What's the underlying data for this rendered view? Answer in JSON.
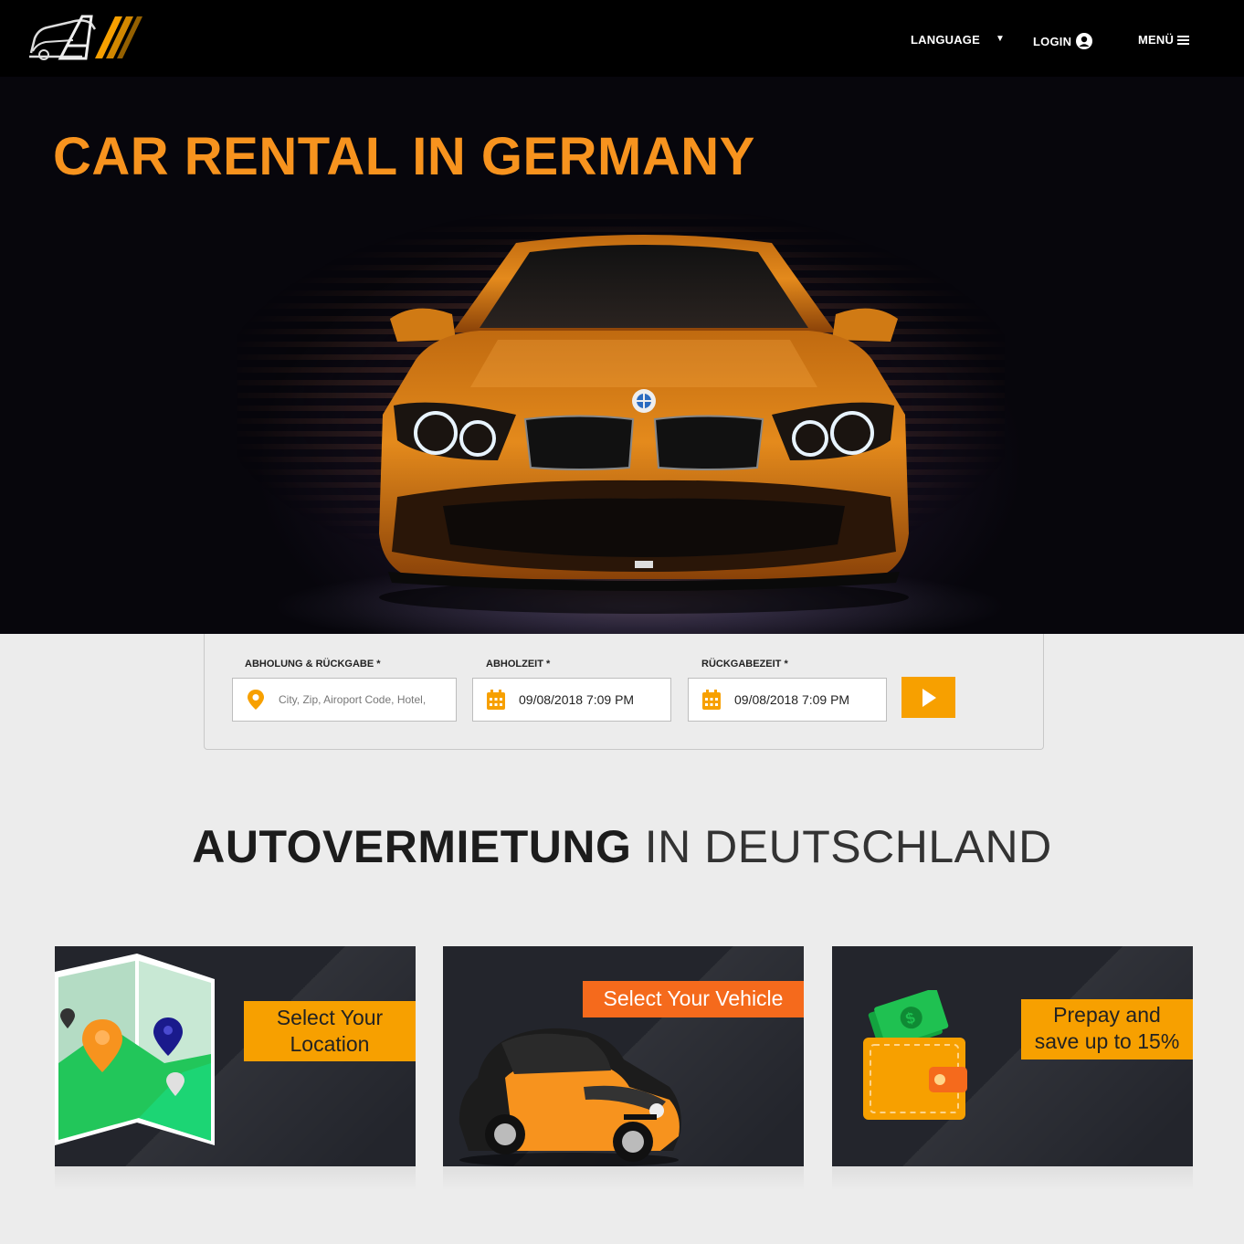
{
  "header": {
    "logo_text": "A",
    "nav": {
      "language_label": "LANGUAGE",
      "login_label": "LOGIN",
      "menu_label": "MENÜ"
    }
  },
  "hero": {
    "title": "CAR RENTAL IN GERMANY"
  },
  "search": {
    "pickup_label": "ABHOLUNG & RÜCKGABE *",
    "pickup_placeholder": "City, Zip, Airoport Code, Hotel,",
    "pickup_time_label": "ABHOLZEIT *",
    "pickup_time_value": "09/08/2018 7:09 PM",
    "return_time_label": "RÜCKGABEZEIT *",
    "return_time_value": "09/08/2018 7:09 PM"
  },
  "section": {
    "title_bold": "AUTOVERMIETUNG",
    "title_light": "IN DEUTSCHLAND"
  },
  "features": [
    {
      "line1": "Select Your",
      "line2": "Location"
    },
    {
      "line1": "Select Your Vehicle",
      "line2": ""
    },
    {
      "line1": "Prepay and",
      "line2": "save up to 15%"
    }
  ],
  "colors": {
    "accent": "#f7a000",
    "accent_alt": "#f56a1c",
    "title_orange": "#f7931e",
    "card_bg": "#23252c"
  }
}
